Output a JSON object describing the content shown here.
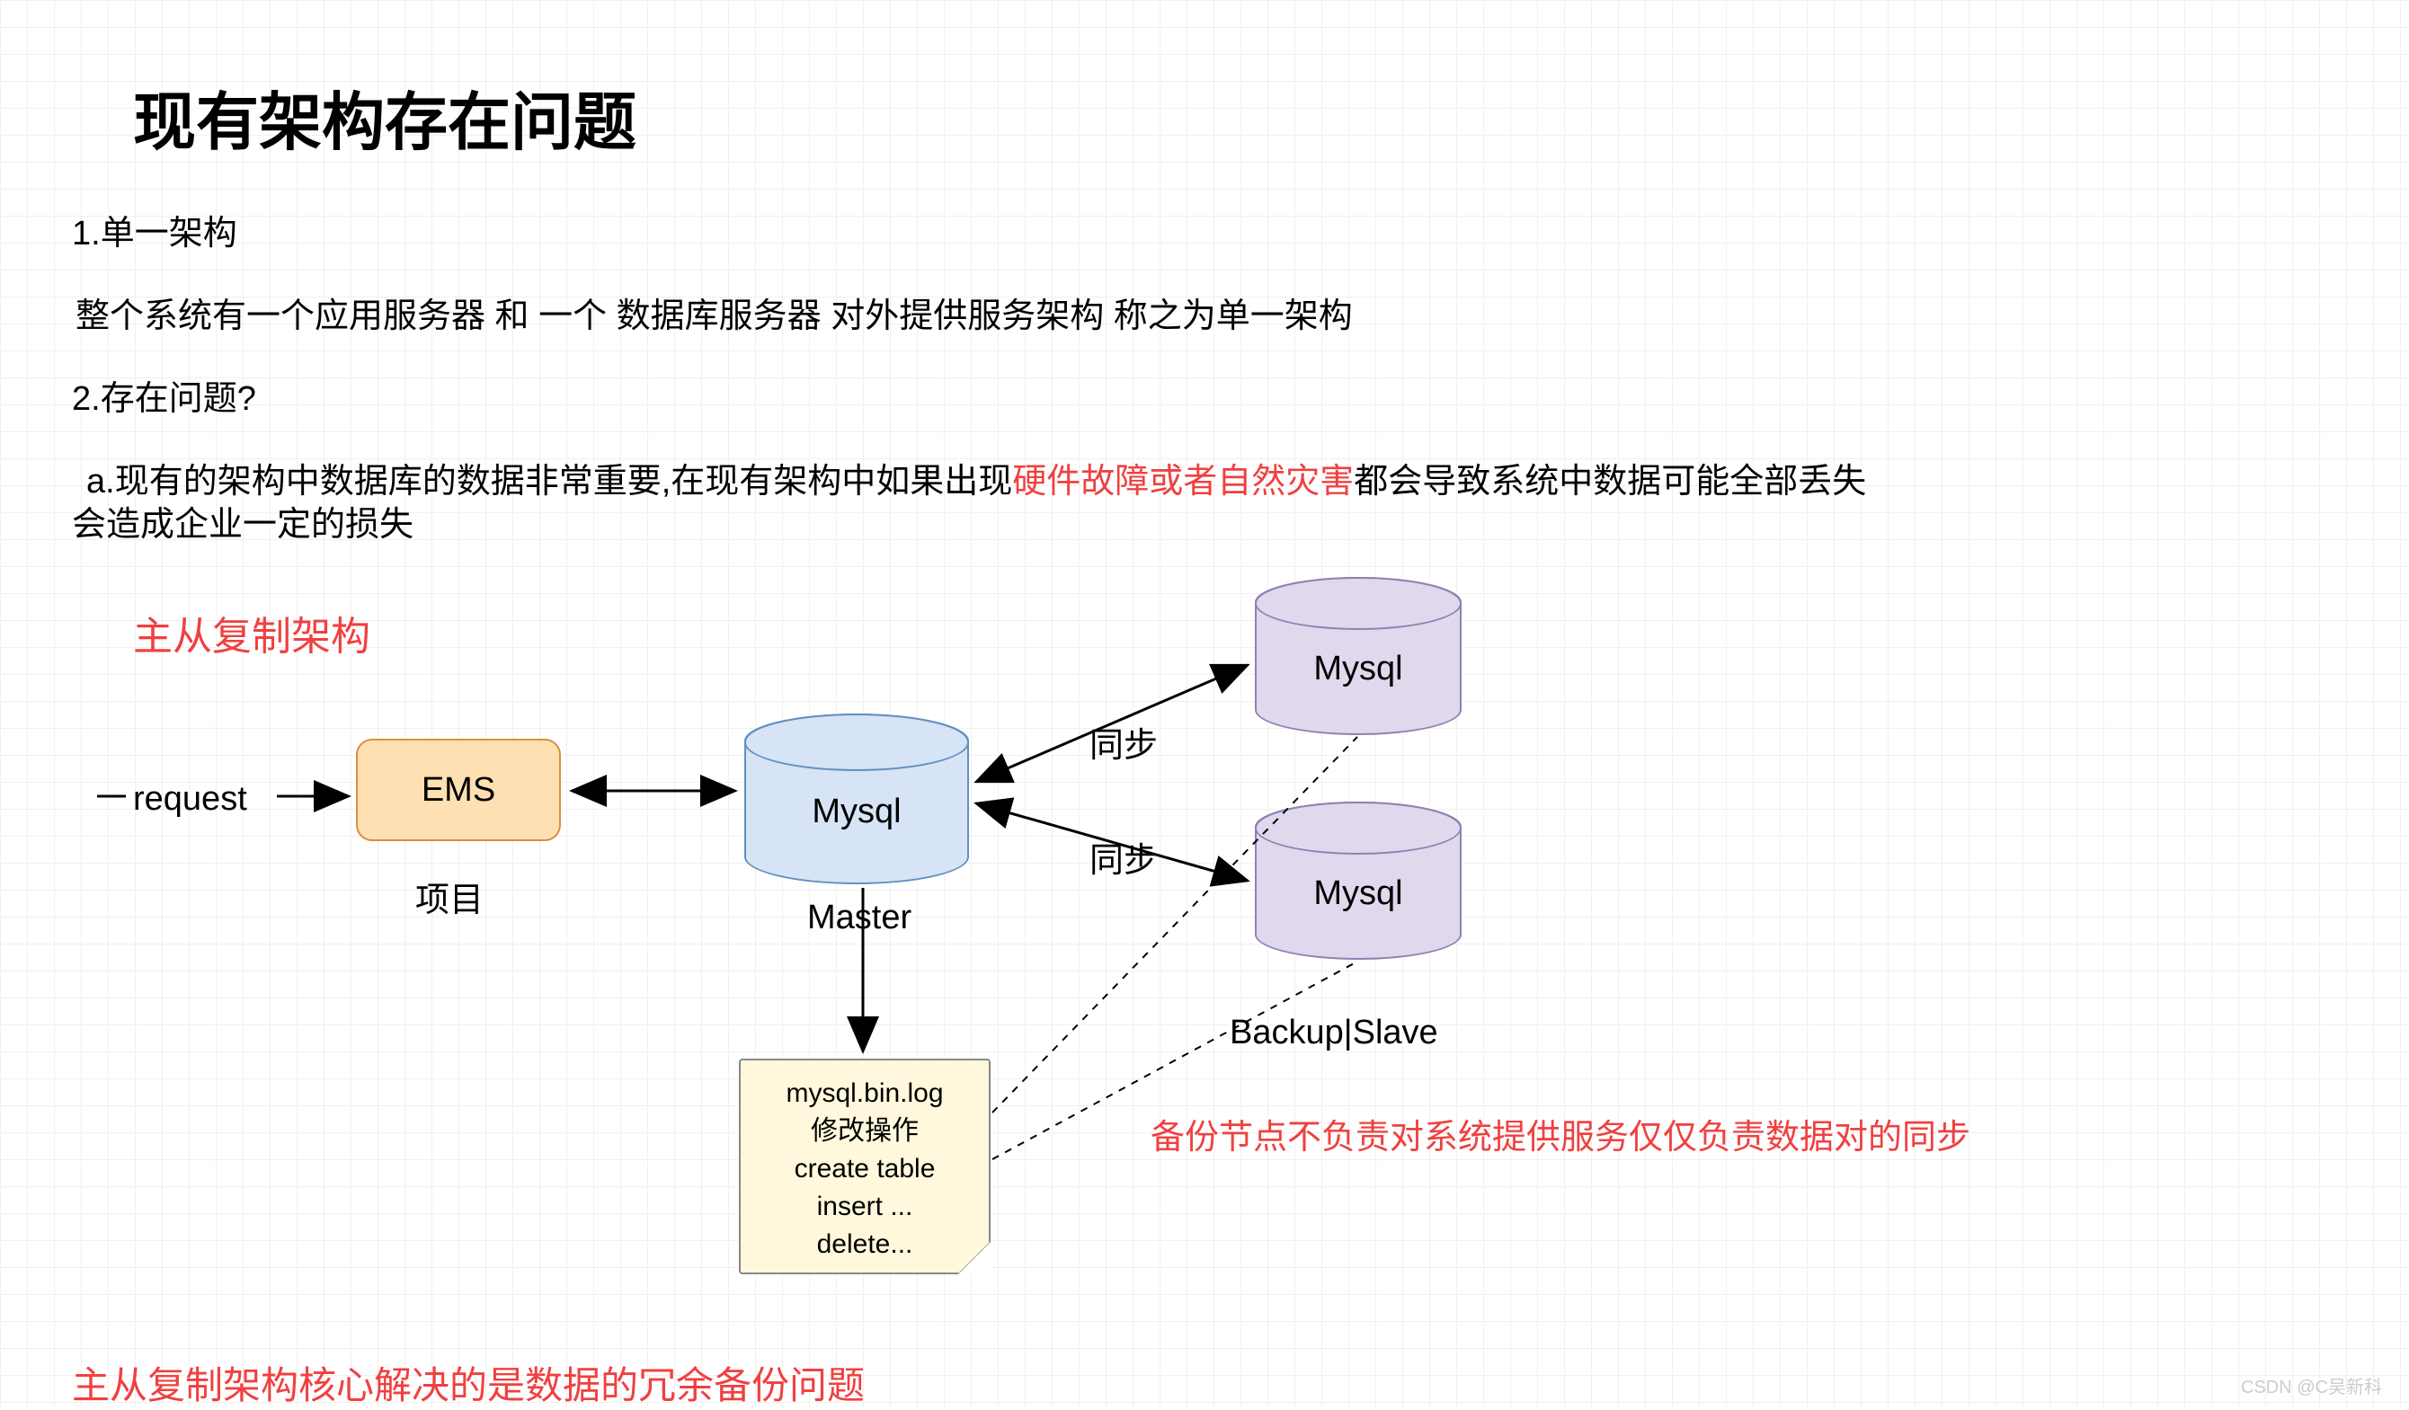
{
  "title": "现有架构存在问题",
  "lines": {
    "l1": "1.单一架构",
    "l2": "整个系统有一个应用服务器 和 一个 数据库服务器 对外提供服务架构 称之为单一架构",
    "l3": "2.存在问题?",
    "l4a": "a.现有的架构中数据库的数据非常重要,在现有架构中如果出现",
    "l4b": "硬件故障或者自然灾害",
    "l4c": "都会导致系统中数据可能全部丢失",
    "l5": "会造成企业一定的损失"
  },
  "arch_label": "主从复制架构",
  "request": "request",
  "ems": "EMS",
  "proj": "项目",
  "master": "Master",
  "mysql": "Mysql",
  "sync": "同步",
  "backup": "Backup|Slave",
  "backup_note": "备份节点不负责对系统提供服务仅仅负责数据对的同步",
  "note_lines": {
    "n1": "mysql.bin.log",
    "n2": "修改操作",
    "n3": "create table",
    "n4": "insert ...",
    "n5": "delete..."
  },
  "bottom": "主从复制架构核心解决的是数据的冗余备份问题",
  "watermark": "CSDN @C吴新科"
}
